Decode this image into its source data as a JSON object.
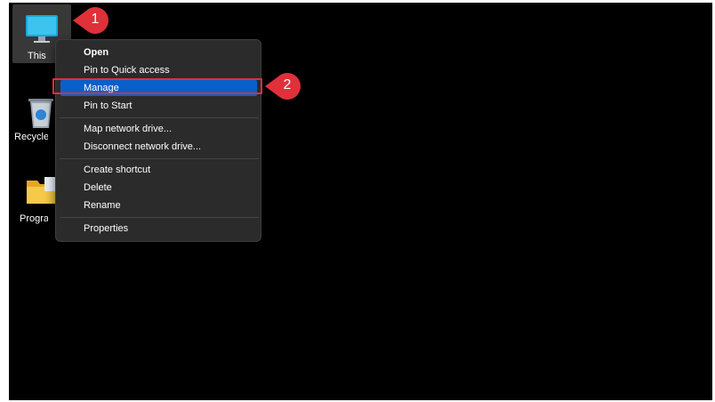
{
  "desktop": {
    "icons": [
      {
        "label": "This PC",
        "icon": "monitor-icon"
      },
      {
        "label": "Recycle Bin",
        "icon": "recycle-bin-icon"
      },
      {
        "label": "Programs",
        "icon": "folder-icon"
      }
    ]
  },
  "context_menu": {
    "items": [
      {
        "label": "Open",
        "bold": true
      },
      {
        "label": "Pin to Quick access"
      },
      {
        "label": "Manage",
        "selected": true
      },
      {
        "label": "Pin to Start"
      },
      {
        "label": "Map network drive..."
      },
      {
        "label": "Disconnect network drive..."
      },
      {
        "label": "Create shortcut"
      },
      {
        "label": "Delete"
      },
      {
        "label": "Rename"
      },
      {
        "label": "Properties"
      }
    ]
  },
  "annotations": {
    "step1": "1",
    "step2": "2",
    "callout_color": "#e0303a",
    "selection_color": "#0a5fc9"
  }
}
